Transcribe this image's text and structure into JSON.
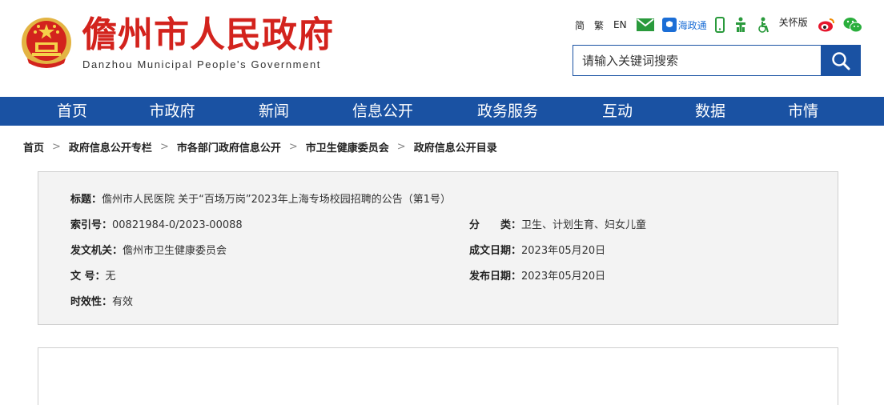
{
  "header": {
    "title": "儋州市人民政府",
    "subtitle": "Danzhou Municipal People's Government",
    "toolbar": {
      "simplified": "简",
      "traditional": "繁",
      "english": "EN",
      "haizhengtong": "海政通",
      "care_mode": "关怀版"
    },
    "search": {
      "placeholder": "请输入关键词搜索"
    }
  },
  "nav": {
    "items": [
      "首页",
      "市政府",
      "新闻",
      "信息公开",
      "政务服务",
      "互动",
      "数据",
      "市情"
    ]
  },
  "breadcrumb": {
    "items": [
      "首页",
      "政府信息公开专栏",
      "市各部门政府信息公开",
      "市卫生健康委员会",
      "政府信息公开目录"
    ],
    "separator": ">"
  },
  "info": {
    "title_label": "标题：",
    "title_value": "儋州市人民医院 关于“百场万岗”2023年上海专场校园招聘的公告（第1号）",
    "index_label": "索引号：",
    "index_value": "00821984-0/2023-00088",
    "category_label": "分　　类：",
    "category_value": "卫生、计划生育、妇女儿童",
    "issuer_label": "发文机关：",
    "issuer_value": "儋州市卫生健康委员会",
    "created_label": "成文日期：",
    "created_value": "2023年05月20日",
    "docno_label": "文 号：",
    "docno_value": "无",
    "published_label": "发布日期：",
    "published_value": "2023年05月20日",
    "validity_label": "时效性：",
    "validity_value": "有效"
  },
  "colors": {
    "brand_blue": "#1a52a3",
    "title_red": "#d3231d"
  },
  "icons": [
    "national-emblem-icon",
    "mail-icon",
    "mobile-icon",
    "accessibility-icon",
    "elderly-icon",
    "weibo-icon",
    "wechat-icon",
    "search-icon"
  ]
}
